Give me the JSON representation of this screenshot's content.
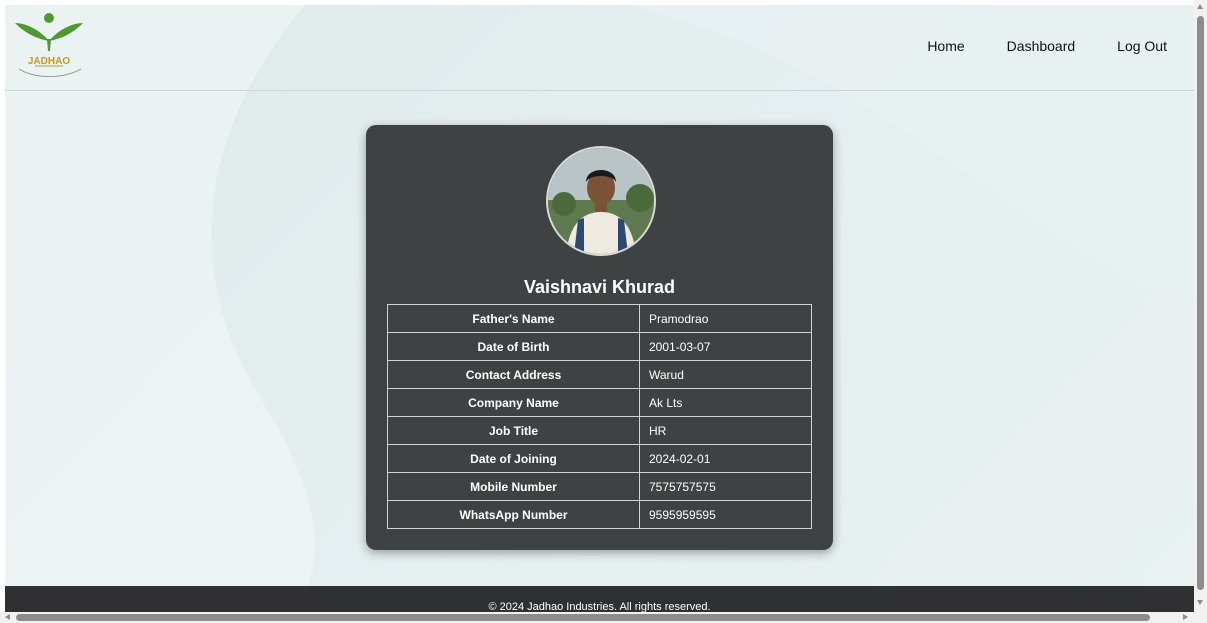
{
  "header": {
    "logo_text": "JADHAO",
    "nav": [
      {
        "label": "Home"
      },
      {
        "label": "Dashboard"
      },
      {
        "label": "Log Out"
      }
    ]
  },
  "profile": {
    "name": "Vaishnavi Khurad",
    "rows": [
      {
        "label": "Father's Name",
        "value": "Pramodrao"
      },
      {
        "label": "Date of Birth",
        "value": "2001-03-07"
      },
      {
        "label": "Contact Address",
        "value": "Warud"
      },
      {
        "label": "Company Name",
        "value": "Ak Lts"
      },
      {
        "label": "Job Title",
        "value": "HR"
      },
      {
        "label": "Date of Joining",
        "value": "2024-02-01"
      },
      {
        "label": "Mobile Number",
        "value": "7575757575"
      },
      {
        "label": "WhatsApp Number",
        "value": "9595959595"
      }
    ]
  },
  "footer": {
    "text": "© 2024 Jadhao Industries. All rights reserved."
  },
  "colors": {
    "card_bg": "#3f4243",
    "footer_bg": "#2f3031",
    "logo_green": "#4f9a2f",
    "logo_text": "#c89a1e"
  }
}
